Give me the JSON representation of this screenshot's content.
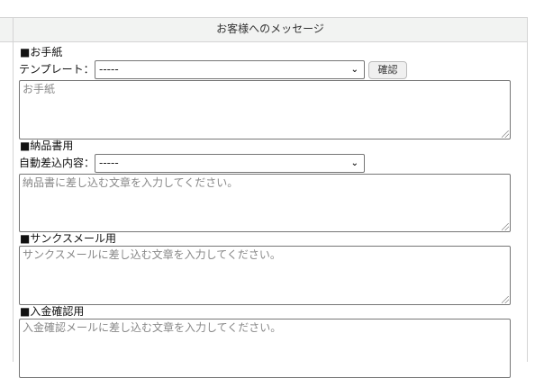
{
  "header": {
    "title": "お客様へのメッセージ"
  },
  "letter": {
    "label": "■お手紙",
    "template_label": "テンプレート：",
    "template_value": "-----",
    "confirm_button": "確認",
    "placeholder": "お手紙"
  },
  "invoice": {
    "label": "■納品書用",
    "auto_label": "自動差込内容：",
    "auto_value": "-----",
    "placeholder": "納品書に差し込む文章を入力してください。"
  },
  "thanks": {
    "label": "■サンクスメール用",
    "placeholder": "サンクスメールに差し込む文章を入力してください。"
  },
  "payment": {
    "label": "■入金確認用",
    "placeholder": "入金確認メールに差し込む文章を入力してください。"
  }
}
